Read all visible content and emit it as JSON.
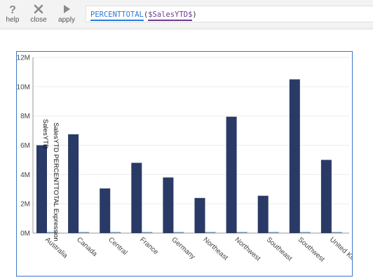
{
  "toolbar": {
    "buttons": [
      {
        "label": "help",
        "icon": "question-icon"
      },
      {
        "label": "close",
        "icon": "x-icon"
      },
      {
        "label": "apply",
        "icon": "play-icon"
      }
    ]
  },
  "formula": {
    "function": "PERCENTTOTAL",
    "open_paren": "(",
    "argument": "$SalesYTD$",
    "close_paren": ")"
  },
  "colors": {
    "bar": "#2a3a66",
    "thin_bar": "#6a8fa8",
    "frame": "#3a78c9",
    "function": "#2b7ad9",
    "argument": "#6a3c8c"
  },
  "chart_data": {
    "type": "bar",
    "categories": [
      "Australia",
      "Canada",
      "Central",
      "France",
      "Germany",
      "Northeast",
      "Northwest",
      "Southeast",
      "Southwest",
      "United Kingdom"
    ],
    "series": [
      {
        "name": "SalesYTD",
        "values": [
          6.0,
          6.75,
          3.05,
          4.8,
          3.8,
          2.4,
          7.95,
          2.55,
          10.5,
          5.0
        ]
      },
      {
        "name": "SalesYTD PERCENTTOTAL Expression",
        "values": [
          0.05,
          0.05,
          0.05,
          0.05,
          0.05,
          0.05,
          0.05,
          0.05,
          0.05,
          0.05
        ]
      }
    ],
    "ylim": [
      0,
      12
    ],
    "yticks": [
      "0M",
      "2M",
      "4M",
      "6M",
      "8M",
      "10M",
      "12M"
    ],
    "ytick_values": [
      0,
      2,
      4,
      6,
      8,
      10,
      12
    ],
    "grid": true,
    "legend": "SalesYTD PERCENTTOTAL Expression, SalesYTD",
    "title": "",
    "xlabel": "",
    "ylabel": ""
  }
}
